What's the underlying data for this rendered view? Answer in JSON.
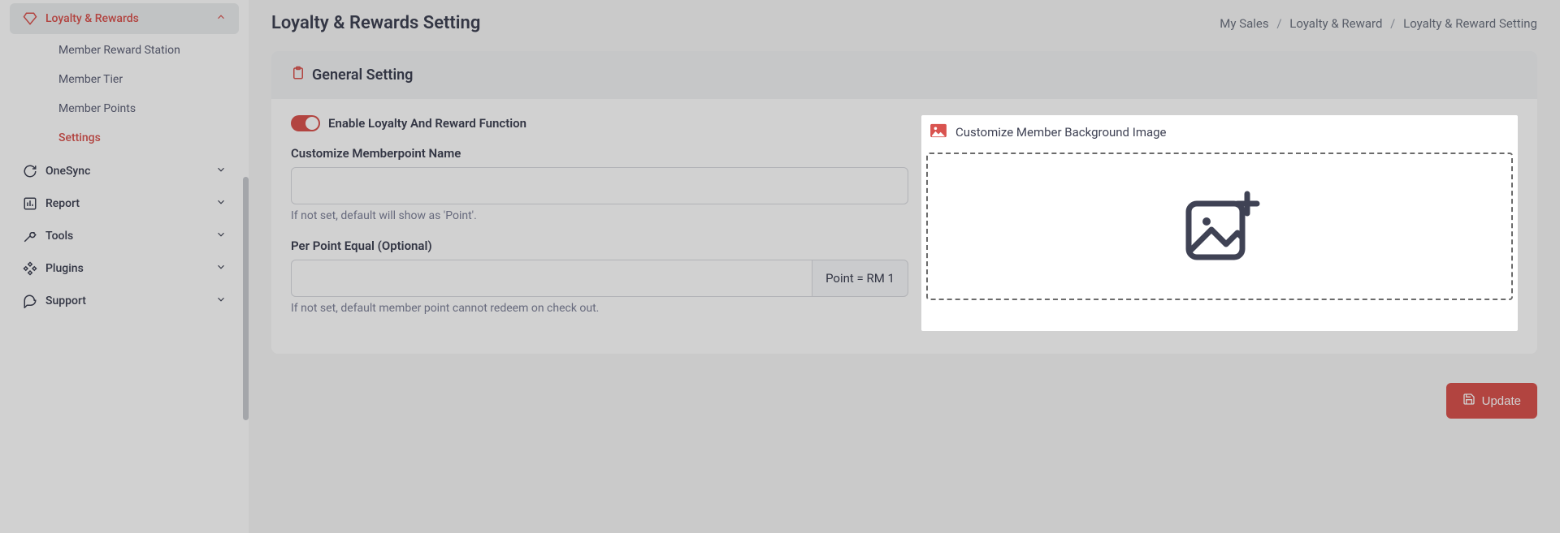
{
  "sidebar": {
    "active_parent": {
      "label": "Loyalty & Rewards"
    },
    "sub_items": [
      {
        "label": "Member Reward Station"
      },
      {
        "label": "Member Tier"
      },
      {
        "label": "Member Points"
      },
      {
        "label": "Settings"
      }
    ],
    "items": [
      {
        "label": "OneSync"
      },
      {
        "label": "Report"
      },
      {
        "label": "Tools"
      },
      {
        "label": "Plugins"
      },
      {
        "label": "Support"
      }
    ]
  },
  "header": {
    "title": "Loyalty & Rewards Setting",
    "breadcrumb": [
      "My Sales",
      "Loyalty & Reward",
      "Loyalty & Reward Setting"
    ],
    "sep": "/"
  },
  "panel": {
    "title": "General Setting",
    "toggle_label": "Enable Loyalty And Reward Function",
    "field1": {
      "label": "Customize Memberpoint Name",
      "value": "",
      "help": "If not set, default will show as 'Point'."
    },
    "field2": {
      "label": "Per Point Equal (Optional)",
      "value": "",
      "addon": "Point = RM 1",
      "help": "If not set, default member point cannot redeem on check out."
    },
    "right": {
      "title": "Customize Member Background Image"
    }
  },
  "footer": {
    "update_label": "Update"
  }
}
